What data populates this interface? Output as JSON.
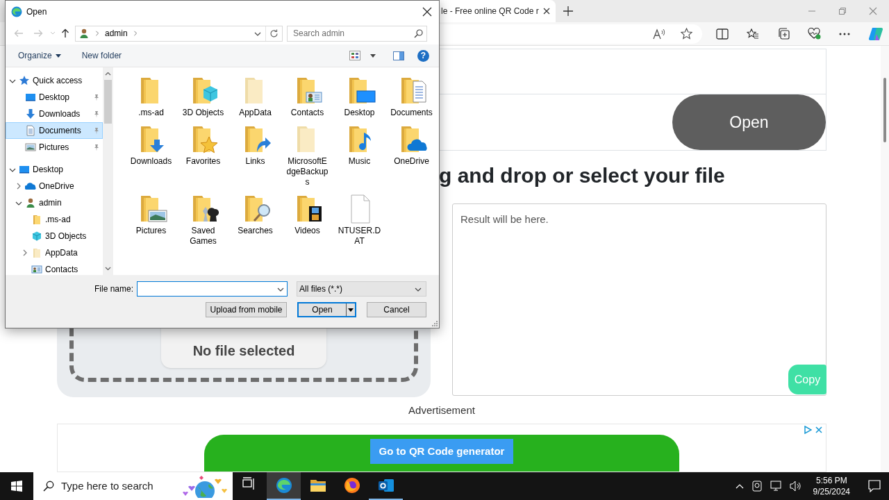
{
  "browser": {
    "tab_title": "le - Free online QR Code r",
    "page": {
      "open_button": "Open",
      "heading": "g and drop or select your file",
      "drop_status": "No file selected",
      "result_placeholder": "Result will be here.",
      "copy_button": "Copy",
      "ad_label": "Advertisement",
      "ad_button": "Go to QR Code generator"
    }
  },
  "dialog": {
    "title": "Open",
    "path": [
      "admin"
    ],
    "search_placeholder": "Search admin",
    "toolbar": [
      "Organize",
      "New folder"
    ],
    "help_button": "?",
    "nav_tree": [
      {
        "label": "Quick access",
        "kind": "star",
        "expanded": true,
        "selected": false,
        "children": [
          {
            "label": "Desktop",
            "kind": "desktop",
            "pinned": true,
            "selected": false
          },
          {
            "label": "Downloads",
            "kind": "downloads",
            "pinned": true,
            "selected": false
          },
          {
            "label": "Documents",
            "kind": "documents",
            "pinned": true,
            "selected": true
          },
          {
            "label": "Pictures",
            "kind": "pictures",
            "pinned": true,
            "selected": false
          }
        ]
      },
      {
        "label": "Desktop",
        "kind": "desktop",
        "expanded": true,
        "selected": false,
        "children": [
          {
            "label": "OneDrive",
            "kind": "onedrive",
            "expanded": false,
            "selected": false
          },
          {
            "label": "admin",
            "kind": "user",
            "expanded": true,
            "selected": false,
            "children": [
              {
                "label": ".ms-ad",
                "kind": "folder",
                "selected": false
              },
              {
                "label": "3D Objects",
                "kind": "cube",
                "selected": false
              },
              {
                "label": "AppData",
                "kind": "faded",
                "expanded": false,
                "selected": false
              },
              {
                "label": "Contacts",
                "kind": "contacts",
                "selected": false
              }
            ]
          }
        ]
      }
    ],
    "items": [
      {
        "label": ".ms-ad",
        "kind": "folder"
      },
      {
        "label": "3D Objects",
        "kind": "cube"
      },
      {
        "label": "AppData",
        "kind": "faded"
      },
      {
        "label": "Contacts",
        "kind": "contacts"
      },
      {
        "label": "Desktop",
        "kind": "desktop"
      },
      {
        "label": "Documents",
        "kind": "documents"
      },
      {
        "label": "Downloads",
        "kind": "downloads"
      },
      {
        "label": "Favorites",
        "kind": "favorites"
      },
      {
        "label": "Links",
        "kind": "links"
      },
      {
        "label": "MicrosoftEdgeBackups",
        "kind": "faded"
      },
      {
        "label": "Music",
        "kind": "music"
      },
      {
        "label": "OneDrive",
        "kind": "onedrive"
      },
      {
        "label": "Pictures",
        "kind": "pictures"
      },
      {
        "label": "Saved Games",
        "kind": "games"
      },
      {
        "label": "Searches",
        "kind": "searches"
      },
      {
        "label": "Videos",
        "kind": "videos"
      },
      {
        "label": "NTUSER.DAT",
        "kind": "file"
      }
    ],
    "file_name_label": "File name:",
    "file_type": "All files (*.*)",
    "buttons": [
      {
        "label": "Upload from mobile",
        "default": false,
        "split": false
      },
      {
        "label": "Open",
        "default": true,
        "split": true
      },
      {
        "label": "Cancel",
        "default": false,
        "split": false
      }
    ]
  },
  "taskbar": {
    "search_placeholder": "Type here to search",
    "apps": [
      {
        "kind": "taskview",
        "active": false,
        "running": false
      },
      {
        "kind": "edge",
        "active": true,
        "running": true
      },
      {
        "kind": "explorer",
        "active": false,
        "running": false
      },
      {
        "kind": "firefox",
        "active": false,
        "running": false
      },
      {
        "kind": "outlook",
        "active": false,
        "running": true
      }
    ],
    "time": "5:56 PM",
    "date": "9/25/2024"
  }
}
